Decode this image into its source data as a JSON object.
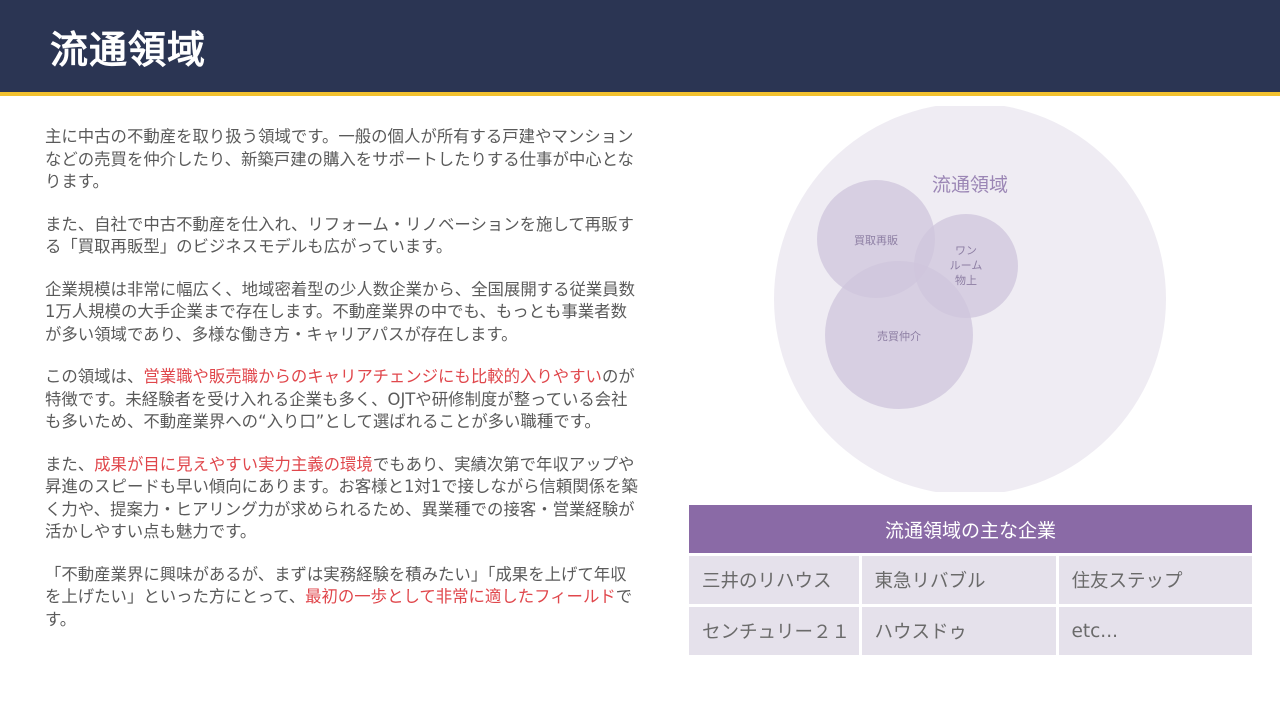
{
  "header": {
    "title": "流通領域"
  },
  "body": {
    "paragraphs": [
      [
        {
          "text": "主に中古の不動産を取り扱う領域です。一般の個人が所有する戸建やマンションなどの売買を仲介したり、新築戸建の購入をサポートしたりする仕事が中心となります。",
          "highlight": false
        }
      ],
      [
        {
          "text": "また、自社で中古不動産を仕入れ、リフォーム・リノベーションを施して再販する「買取再販型」のビジネスモデルも広がっています。",
          "highlight": false
        }
      ],
      [
        {
          "text": "企業規模は非常に幅広く、地域密着型の少人数企業から、全国展開する従業員数1万人規模の大手企業まで存在します。不動産業界の中でも、もっとも事業者数が多い領域であり、多様な働き方・キャリアパスが存在します。",
          "highlight": false
        }
      ],
      [
        {
          "text": "この領域は、",
          "highlight": false
        },
        {
          "text": "営業職や販売職からのキャリアチェンジにも比較的入りやすい",
          "highlight": true
        },
        {
          "text": "のが特徴です。未経験者を受け入れる企業も多く、OJTや研修制度が整っている会社も多いため、不動産業界への“入り口”として選ばれることが多い職種です。",
          "highlight": false
        }
      ],
      [
        {
          "text": "また、",
          "highlight": false
        },
        {
          "text": "成果が目に見えやすい実力主義の環境",
          "highlight": true
        },
        {
          "text": "でもあり、実績次第で年収アップや昇進のスピードも早い傾向にあります。お客様と1対1で接しながら信頼関係を築く力や、提案力・ヒアリング力が求められるため、異業種での接客・営業経験が活かしやすい点も魅力です。",
          "highlight": false
        }
      ],
      [
        {
          "text": "「不動産業界に興味があるが、まずは実務経験を積みたい」「成果を上げて年収を上げたい」といった方にとって、",
          "highlight": false
        },
        {
          "text": "最初の一歩として非常に適したフィールド",
          "highlight": true
        },
        {
          "text": "です。",
          "highlight": false
        }
      ]
    ],
    "highlight_color": "#e0474c"
  },
  "diagram": {
    "outer_label": "流通領域",
    "circles": [
      {
        "label_lines": [
          "買取再販"
        ]
      },
      {
        "label_lines": [
          "ワン",
          "ルーム",
          "物上"
        ]
      },
      {
        "label_lines": [
          "売買仲介"
        ]
      }
    ]
  },
  "companies": {
    "header": "流通領域の主な企業",
    "rows": [
      [
        "三井のリハウス",
        "東急リバブル",
        "住友ステップ"
      ],
      [
        "センチュリー２１",
        "ハウスドゥ",
        "etc..."
      ]
    ]
  },
  "colors": {
    "header_bg": "#2b3553",
    "accent_rule": "#f2c12e",
    "table_header": "#8a6aa6",
    "table_cell": "#e5e1eb",
    "diagram_fill": "#efecf3"
  }
}
